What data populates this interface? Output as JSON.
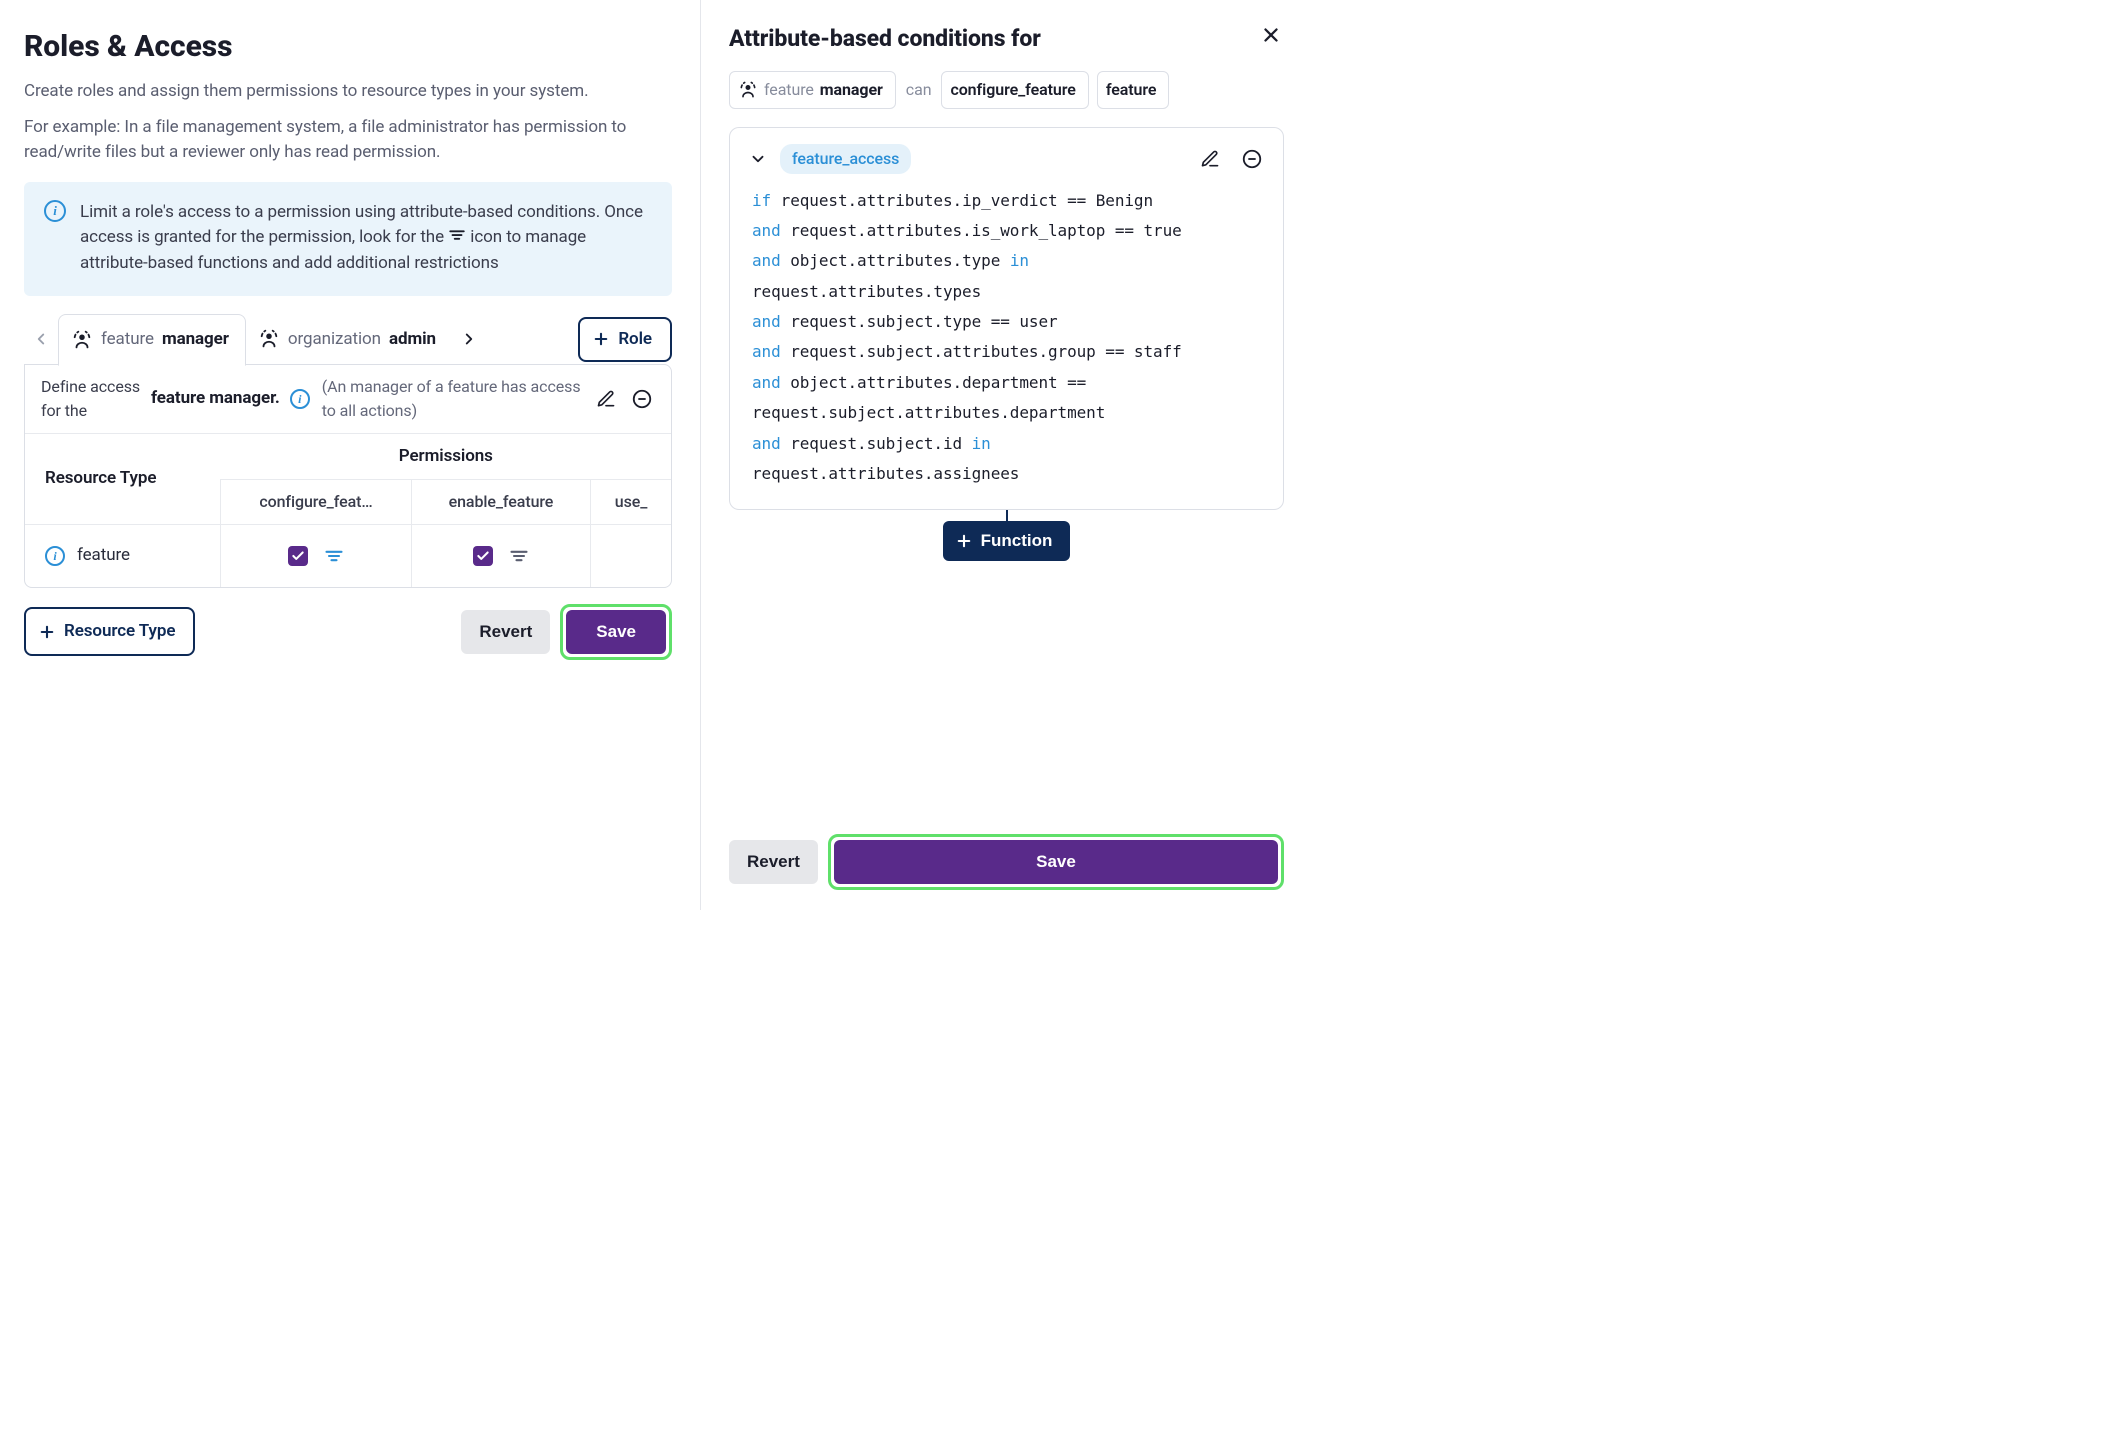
{
  "left": {
    "title": "Roles & Access",
    "subtitle1": "Create roles and assign them permissions to resource types in your system.",
    "subtitle2": "For example: In a file management system, a file administrator has permission to read/write files but a reviewer only has read permission.",
    "banner": "Limit a role's access to a permission using attribute-based conditions. Once access is granted for the permission, look for the  icon to manage attribute-based functions and add additional restrictions",
    "banner_part1": "Limit a role's access to a permission using attribute-based conditions. Once access is granted for the permission, look for the ",
    "banner_part2": " icon to manage attribute-based functions and add additional restrictions",
    "tabs": {
      "tab1_pref": "feature",
      "tab1_name": "manager",
      "tab2_pref": "organization",
      "tab2_name": "admin"
    },
    "add_role_label": "Role",
    "role_header": {
      "define_text": "Define access for the",
      "role_title": "feature manager.",
      "role_desc": "(An manager of a feature has access to all actions)"
    },
    "table": {
      "rt_header": "Resource Type",
      "perm_header": "Permissions",
      "cols": {
        "c1": "configure_feat…",
        "c2": "enable_feature",
        "c3": "use_"
      },
      "row1_name": "feature"
    },
    "actions": {
      "add_resource": "Resource Type",
      "revert": "Revert",
      "save": "Save"
    }
  },
  "right": {
    "title": "Attribute-based conditions for",
    "chips": {
      "role_pref": "feature",
      "role_name": "manager",
      "can": "can",
      "action": "configure_feature",
      "resource": "feature"
    },
    "func_name": "feature_access",
    "code_lines": [
      {
        "kw": "if",
        "rest": " request.attributes.ip_verdict == Benign"
      },
      {
        "kw": "and",
        "rest": " request.attributes.is_work_laptop == true"
      },
      {
        "kw": "and",
        "rest": " object.attributes.type ",
        "mid_kw": "in",
        "rest2": " request.attributes.types"
      },
      {
        "kw": "and",
        "rest": " request.subject.type == user"
      },
      {
        "kw": "and",
        "rest": " request.subject.attributes.group == staff"
      },
      {
        "kw": "and",
        "rest": " object.attributes.department == request.subject.attributes.department"
      },
      {
        "kw": "and",
        "rest": " request.subject.id ",
        "mid_kw": "in",
        "rest2": " request.attributes.assignees"
      }
    ],
    "add_function": "Function",
    "revert": "Revert",
    "save": "Save"
  }
}
